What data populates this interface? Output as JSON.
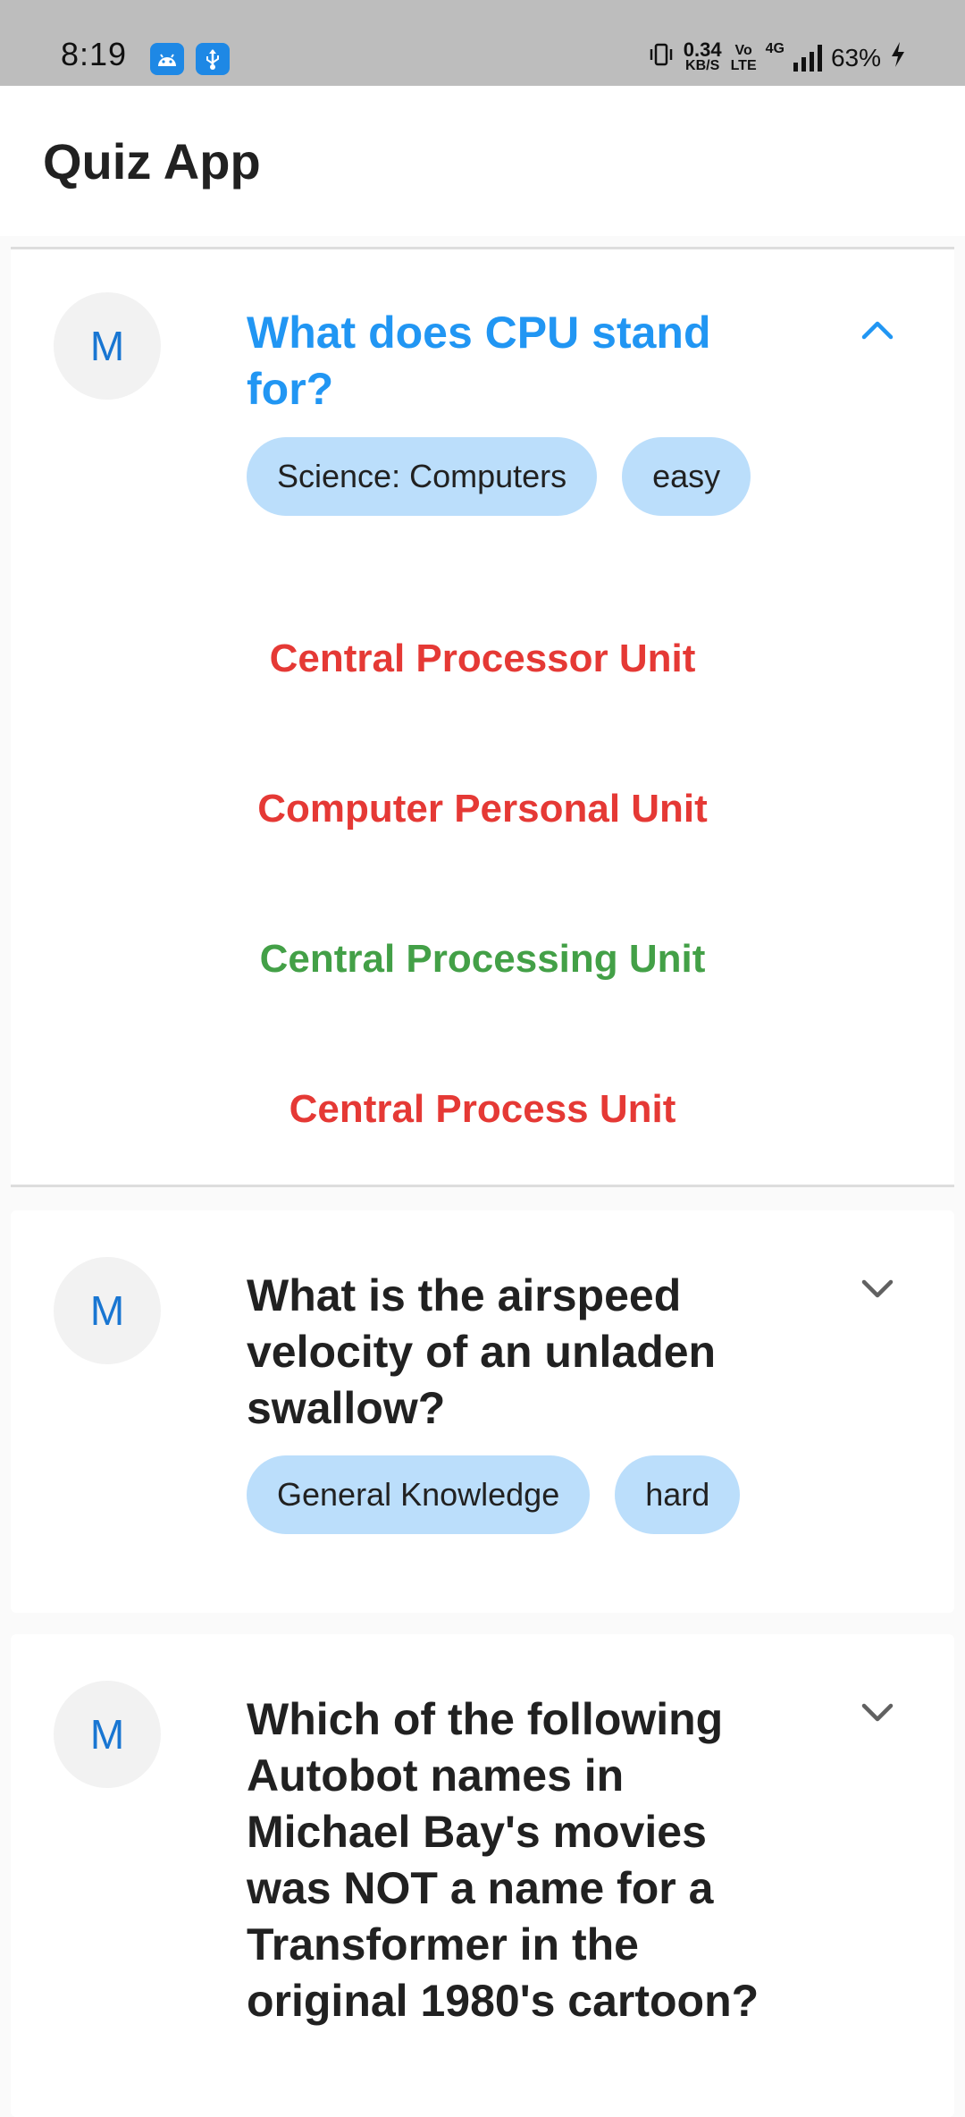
{
  "status_bar": {
    "time": "8:19",
    "net_speed_value": "0.34",
    "net_speed_unit": "KB/S",
    "volte_top": "Vo",
    "volte_bottom": "LTE",
    "network": "4G",
    "battery": "63%",
    "icons": [
      "android-icon",
      "usb-icon",
      "vibrate-icon",
      "signal-icon",
      "charging-icon"
    ]
  },
  "app_bar": {
    "title": "Quiz App"
  },
  "colors": {
    "accent": "#2196f3",
    "chip": "#bbdefb",
    "wrong": "#e53935",
    "correct": "#43a047",
    "avatar_text": "#1976d2"
  },
  "questions": [
    {
      "avatar": "M",
      "question": "What does CPU stand for?",
      "category": "Science: Computers",
      "difficulty": "easy",
      "expanded": true,
      "answers": [
        {
          "text": "Central Processor Unit",
          "correct": false
        },
        {
          "text": "Computer Personal Unit",
          "correct": false
        },
        {
          "text": "Central Processing Unit",
          "correct": true
        },
        {
          "text": "Central Process Unit",
          "correct": false
        }
      ]
    },
    {
      "avatar": "M",
      "question": "What is the airspeed velocity of an unladen swallow?",
      "category": "General Knowledge",
      "difficulty": "hard",
      "expanded": false
    },
    {
      "avatar": "M",
      "question": "Which of the following Autobot names in Michael Bay's movies was NOT a name for a Transformer in the original 1980's cartoon?",
      "expanded": false
    }
  ]
}
